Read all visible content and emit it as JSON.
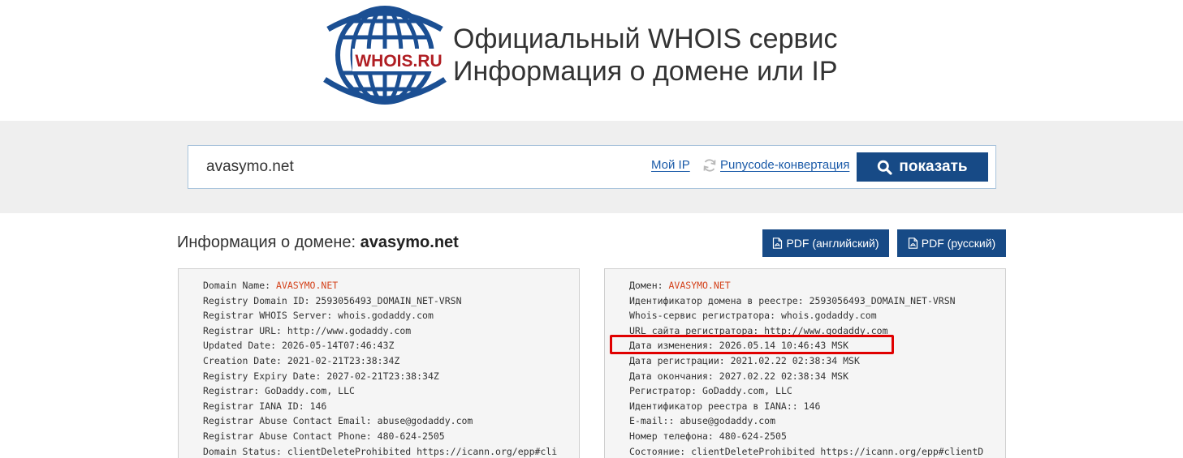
{
  "header": {
    "logo_text": "WHOIS.RU",
    "title_line1": "Официальный WHOIS сервис",
    "title_line2": "Информация о домене или IP"
  },
  "search": {
    "value": "avasymo.net",
    "my_ip_label": "Мой IP",
    "punycode_label": "Punycode-конвертация",
    "show_button_label": "показать"
  },
  "section": {
    "title_prefix": "Информация о домене:",
    "domain": "avasymo.net",
    "pdf_en_label": "PDF (английский)",
    "pdf_ru_label": "PDF (русский)"
  },
  "whois_en": [
    {
      "label": "Domain Name: ",
      "value": "AVASYMO.NET",
      "highlight": true
    },
    {
      "label": "Registry Domain ID: ",
      "value": "2593056493_DOMAIN_NET-VRSN"
    },
    {
      "label": "Registrar WHOIS Server: ",
      "value": "whois.godaddy.com"
    },
    {
      "label": "Registrar URL: ",
      "value": "http://www.godaddy.com"
    },
    {
      "label": "Updated Date: ",
      "value": "2026-05-14T07:46:43Z"
    },
    {
      "label": "Creation Date: ",
      "value": "2021-02-21T23:38:34Z"
    },
    {
      "label": "Registry Expiry Date: ",
      "value": "2027-02-21T23:38:34Z"
    },
    {
      "label": "Registrar: ",
      "value": "GoDaddy.com, LLC"
    },
    {
      "label": "Registrar IANA ID: ",
      "value": "146"
    },
    {
      "label": "Registrar Abuse Contact Email: ",
      "value": "abuse@godaddy.com"
    },
    {
      "label": "Registrar Abuse Contact Phone: ",
      "value": "480-624-2505"
    },
    {
      "label": "Domain Status: ",
      "value": "clientDeleteProhibited https://icann.org/epp#cli"
    }
  ],
  "whois_ru": [
    {
      "label": "Домен: ",
      "value": "AVASYMO.NET",
      "highlight": true
    },
    {
      "label": "Идентификатор домена в реестре: ",
      "value": "2593056493_DOMAIN_NET-VRSN"
    },
    {
      "label": "Whois-сервис регистратора: ",
      "value": "whois.godaddy.com"
    },
    {
      "label": "URL сайта регистратора: ",
      "value": "http://www.godaddy.com"
    },
    {
      "label": "Дата изменения: ",
      "value": "2026.05.14 10:46:43 MSK"
    },
    {
      "label": "Дата регистрации: ",
      "value": "2021.02.22 02:38:34 MSK"
    },
    {
      "label": "Дата окончания: ",
      "value": "2027.02.22 02:38:34 MSK"
    },
    {
      "label": "Регистратор: ",
      "value": "GoDaddy.com, LLC"
    },
    {
      "label": "Идентификатор реестра в IANA:: ",
      "value": "146"
    },
    {
      "label": "E-mail:: ",
      "value": "abuse@godaddy.com"
    },
    {
      "label": "Номер телефона: ",
      "value": "480-624-2505"
    },
    {
      "label": "Состояние: ",
      "value": "clientDeleteProhibited https://icann.org/epp#clientD"
    }
  ],
  "colors": {
    "brand_blue": "#174a86",
    "link_blue": "#1a5aa8",
    "domain_highlight": "#d4431c",
    "annotation_red": "#e00000"
  },
  "icons": {
    "search": "search-icon",
    "refresh": "refresh-icon",
    "pdf": "pdf-file-icon",
    "logo": "globe-logo-icon"
  }
}
